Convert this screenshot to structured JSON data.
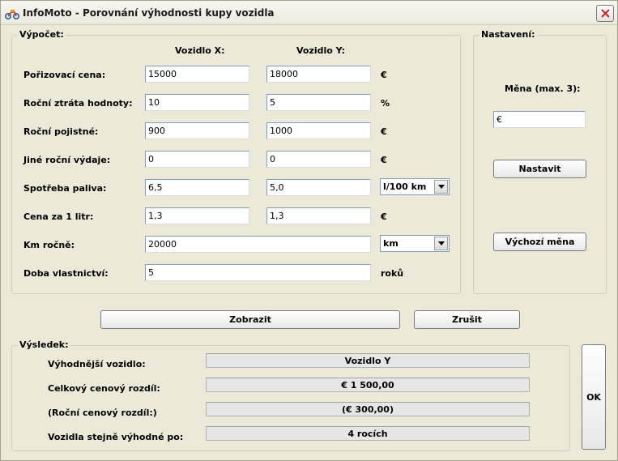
{
  "window": {
    "title": "InfoMoto - Porovnání výhodnosti kupy vozidla"
  },
  "calc": {
    "group_label": "Výpočet:",
    "col_x": "Vozidlo X:",
    "col_y": "Vozidlo Y:",
    "rows": [
      {
        "label": "Pořizovací cena:",
        "x": "15000",
        "y": "18000",
        "unit": "€"
      },
      {
        "label": "Roční ztráta hodnoty:",
        "x": "10",
        "y": "5",
        "unit": "%"
      },
      {
        "label": "Roční pojistné:",
        "x": "900",
        "y": "1000",
        "unit": "€"
      },
      {
        "label": "Jiné roční výdaje:",
        "x": "0",
        "y": "0",
        "unit": "€"
      },
      {
        "label": "Spotřeba paliva:",
        "x": "6,5",
        "y": "5,0",
        "unit_select": "l/100 km"
      },
      {
        "label": "Cena za 1 litr:",
        "x": "1,3",
        "y": "1,3",
        "unit": "€"
      }
    ],
    "km_label": "Km ročně:",
    "km_value": "20000",
    "km_unit": "km",
    "years_label": "Doba vlastnictví:",
    "years_value": "5",
    "years_unit": "roků"
  },
  "settings": {
    "group_label": "Nastavení:",
    "currency_label": "Měna (max. 3):",
    "currency_value": "€",
    "set_button": "Nastavit",
    "default_button": "Výchozí měna"
  },
  "actions": {
    "show_button": "Zobrazit",
    "cancel_button": "Zrušit",
    "ok_button": "OK"
  },
  "result": {
    "group_label": "Výsledek:",
    "rows": [
      {
        "label": "Výhodnější vozidlo:",
        "value": "Vozidlo Y"
      },
      {
        "label": "Celkový cenový rozdíl:",
        "value": "€ 1 500,00"
      },
      {
        "label": "(Roční cenový rozdíl:)",
        "value": "(€ 300,00)"
      },
      {
        "label": "Vozidla stejně výhodné po:",
        "value": "4 rocích"
      }
    ]
  },
  "icons": {
    "app": "motorbike-icon",
    "close": "close-icon",
    "dropdown": "chevron-down-icon"
  },
  "colors": {
    "close_x": "#c1281b",
    "input_border": "#7f9db9",
    "background": "#ece9d8"
  }
}
